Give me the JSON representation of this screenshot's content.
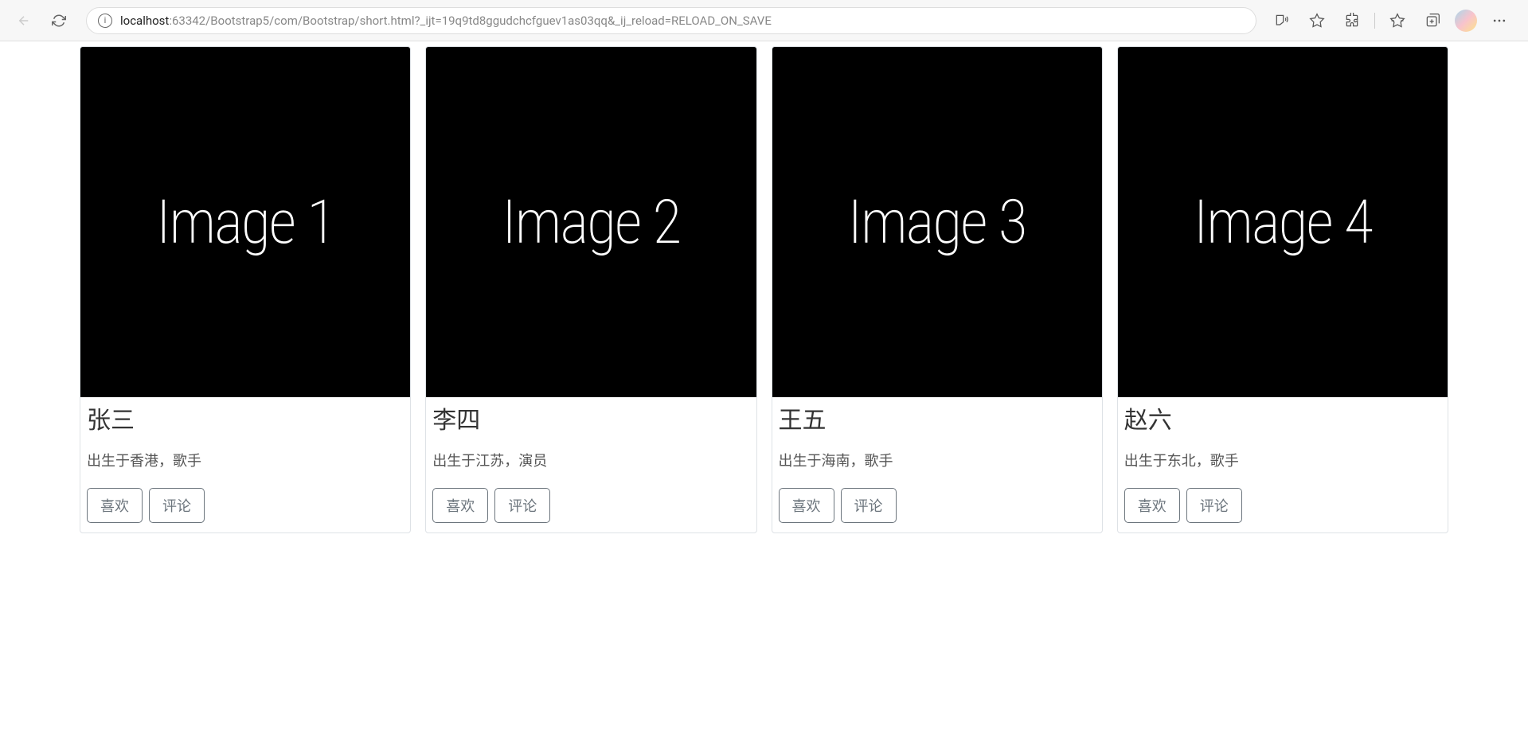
{
  "browser": {
    "url_host": "localhost",
    "url_rest": ":63342/Bootstrap5/com/Bootstrap/short.html?_ijt=19q9td8ggudchcfguev1as03qq&_ij_reload=RELOAD_ON_SAVE"
  },
  "cards": [
    {
      "image_label": "Image 1",
      "title": "张三",
      "subtitle": "出生于香港，歌手",
      "like_label": "喜欢",
      "comment_label": "评论"
    },
    {
      "image_label": "Image 2",
      "title": "李四",
      "subtitle": "出生于江苏，演员",
      "like_label": "喜欢",
      "comment_label": "评论"
    },
    {
      "image_label": "Image 3",
      "title": "王五",
      "subtitle": "出生于海南，歌手",
      "like_label": "喜欢",
      "comment_label": "评论"
    },
    {
      "image_label": "Image 4",
      "title": "赵六",
      "subtitle": "出生于东北，歌手",
      "like_label": "喜欢",
      "comment_label": "评论"
    }
  ]
}
